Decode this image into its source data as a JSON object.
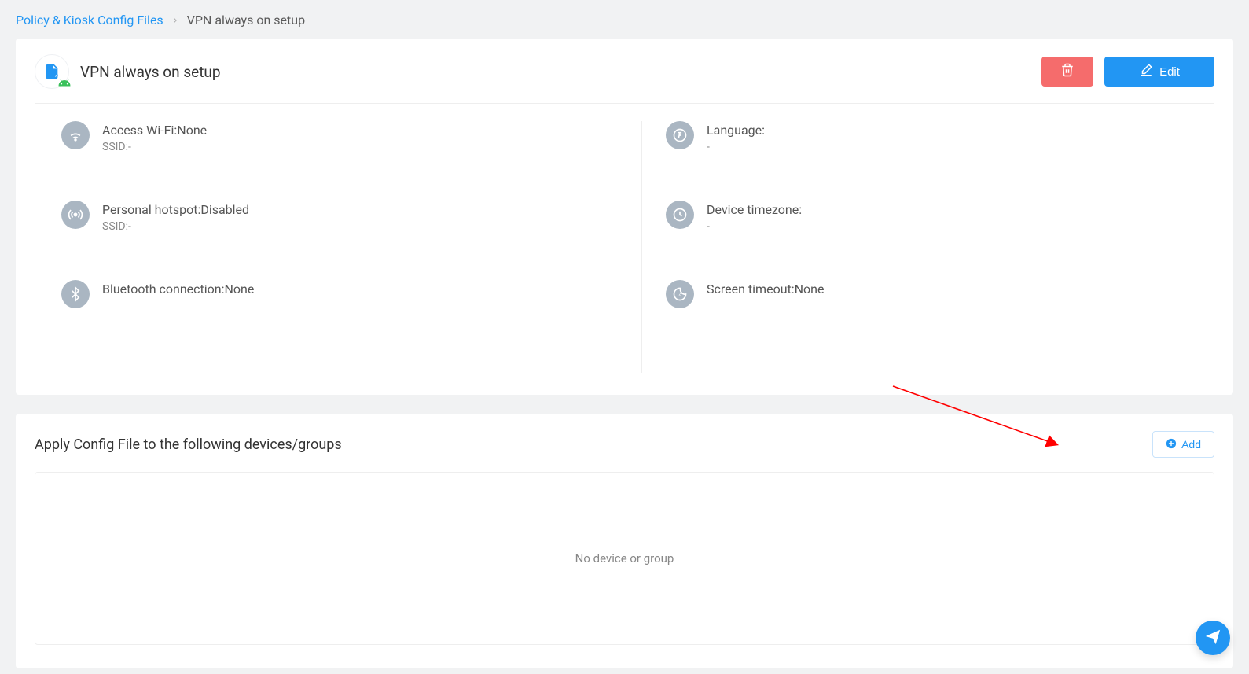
{
  "breadcrumb": {
    "root": "Policy & Kiosk Config Files",
    "current": "VPN always on setup"
  },
  "header": {
    "title": "VPN always on setup",
    "edit_label": "Edit"
  },
  "details": {
    "left": [
      {
        "icon": "wifi",
        "label": "Access Wi-Fi:",
        "value": "None",
        "sub_label": "SSID:",
        "sub_value": "-"
      },
      {
        "icon": "hotspot",
        "label": "Personal hotspot:",
        "value": "Disabled",
        "sub_label": "SSID:",
        "sub_value": "-"
      },
      {
        "icon": "bluetooth",
        "label": "Bluetooth connection:",
        "value": "None"
      }
    ],
    "right": [
      {
        "icon": "language",
        "label": "Language:",
        "sub_value": "-"
      },
      {
        "icon": "clock",
        "label": "Device timezone:",
        "sub_value": "-"
      },
      {
        "icon": "timeout",
        "label": "Screen timeout:",
        "value": "None"
      }
    ]
  },
  "apply": {
    "title": "Apply Config File to the following devices/groups",
    "add_label": "Add",
    "empty_text": "No device or group"
  }
}
